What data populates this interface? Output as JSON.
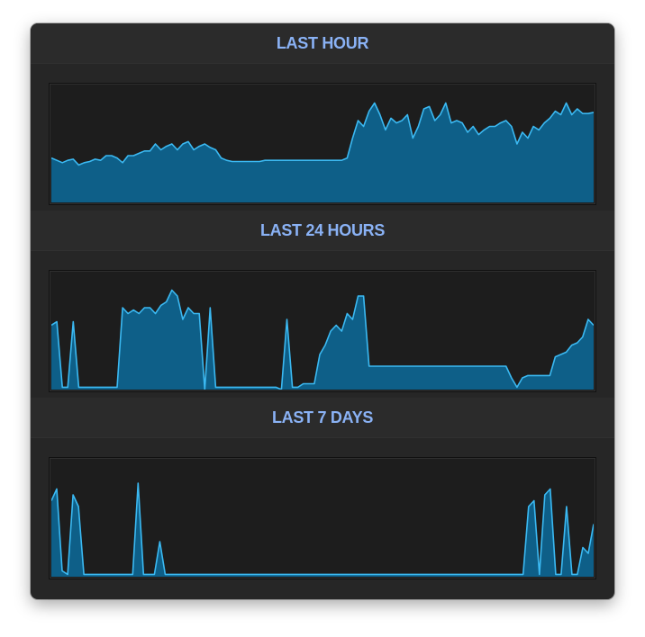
{
  "colors": {
    "title": "#8ab2f5",
    "fill": "#0e5f88",
    "line": "#3bb9f2"
  },
  "sections": [
    {
      "title": "LAST HOUR",
      "series": [
        0.62,
        0.64,
        0.66,
        0.64,
        0.63,
        0.68,
        0.66,
        0.65,
        0.63,
        0.64,
        0.6,
        0.6,
        0.62,
        0.66,
        0.6,
        0.6,
        0.58,
        0.56,
        0.56,
        0.5,
        0.55,
        0.52,
        0.5,
        0.55,
        0.5,
        0.48,
        0.55,
        0.52,
        0.5,
        0.53,
        0.55,
        0.62,
        0.64,
        0.65,
        0.65,
        0.65,
        0.65,
        0.65,
        0.65,
        0.64,
        0.64,
        0.64,
        0.64,
        0.64,
        0.64,
        0.64,
        0.64,
        0.64,
        0.64,
        0.64,
        0.64,
        0.64,
        0.64,
        0.64,
        0.62,
        0.45,
        0.3,
        0.35,
        0.22,
        0.15,
        0.25,
        0.38,
        0.28,
        0.32,
        0.3,
        0.25,
        0.45,
        0.35,
        0.2,
        0.18,
        0.3,
        0.25,
        0.15,
        0.32,
        0.3,
        0.32,
        0.4,
        0.35,
        0.42,
        0.38,
        0.35,
        0.35,
        0.32,
        0.3,
        0.35,
        0.5,
        0.4,
        0.45,
        0.35,
        0.38,
        0.32,
        0.28,
        0.22,
        0.25,
        0.15,
        0.25,
        0.2,
        0.24,
        0.24,
        0.23
      ]
    },
    {
      "title": "LAST 24 HOURS",
      "series": [
        0.45,
        0.42,
        0.98,
        0.98,
        0.42,
        0.98,
        0.98,
        0.98,
        0.98,
        0.98,
        0.98,
        0.98,
        0.98,
        0.3,
        0.35,
        0.32,
        0.35,
        0.3,
        0.3,
        0.35,
        0.28,
        0.25,
        0.15,
        0.2,
        0.4,
        0.3,
        0.35,
        0.35,
        1,
        0.3,
        0.98,
        0.98,
        0.98,
        0.98,
        0.98,
        0.98,
        0.98,
        0.98,
        0.98,
        0.98,
        0.98,
        0.98,
        1,
        0.4,
        0.98,
        0.98,
        0.95,
        0.95,
        0.95,
        0.7,
        0.62,
        0.5,
        0.45,
        0.5,
        0.35,
        0.4,
        0.2,
        0.2,
        0.8,
        0.8,
        0.8,
        0.8,
        0.8,
        0.8,
        0.8,
        0.8,
        0.8,
        0.8,
        0.8,
        0.8,
        0.8,
        0.8,
        0.8,
        0.8,
        0.8,
        0.8,
        0.8,
        0.8,
        0.8,
        0.8,
        0.8,
        0.8,
        0.8,
        0.8,
        0.9,
        0.98,
        0.9,
        0.88,
        0.88,
        0.88,
        0.88,
        0.88,
        0.72,
        0.7,
        0.68,
        0.62,
        0.6,
        0.55,
        0.4,
        0.45
      ]
    },
    {
      "title": "LAST 7 DAYS",
      "series": [
        0.35,
        0.25,
        0.95,
        0.98,
        0.3,
        0.4,
        0.98,
        0.98,
        0.98,
        0.98,
        0.98,
        0.98,
        0.98,
        0.98,
        0.98,
        0.98,
        0.2,
        0.98,
        0.98,
        0.98,
        0.7,
        0.98,
        0.98,
        0.98,
        0.98,
        0.98,
        0.98,
        0.98,
        0.98,
        0.98,
        0.98,
        0.98,
        0.98,
        0.98,
        0.98,
        0.98,
        0.98,
        0.98,
        0.98,
        0.98,
        0.98,
        0.98,
        0.98,
        0.98,
        0.98,
        0.98,
        0.98,
        0.98,
        0.98,
        0.98,
        0.98,
        0.98,
        0.98,
        0.98,
        0.98,
        0.98,
        0.98,
        0.98,
        0.98,
        0.98,
        0.98,
        0.98,
        0.98,
        0.98,
        0.98,
        0.98,
        0.98,
        0.98,
        0.98,
        0.98,
        0.98,
        0.98,
        0.98,
        0.98,
        0.98,
        0.98,
        0.98,
        0.98,
        0.98,
        0.98,
        0.98,
        0.98,
        0.98,
        0.98,
        0.98,
        0.98,
        0.98,
        0.98,
        0.4,
        0.35,
        0.98,
        0.3,
        0.25,
        0.98,
        0.98,
        0.4,
        0.98,
        0.98,
        0.75,
        0.8,
        0.55
      ]
    }
  ]
}
